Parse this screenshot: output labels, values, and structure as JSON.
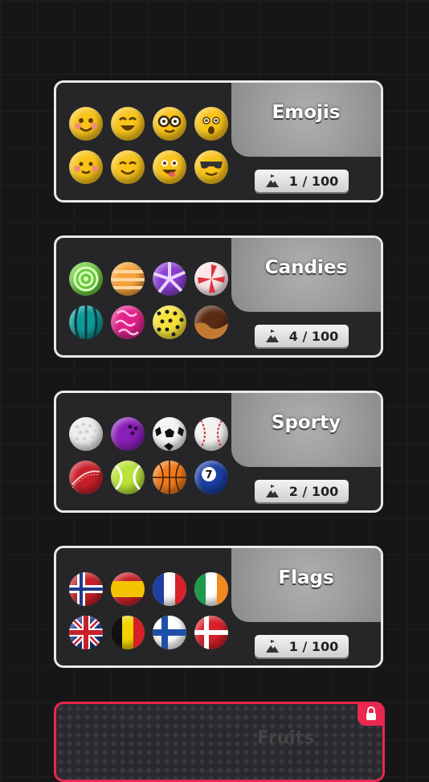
{
  "categories": [
    {
      "name": "Emojis",
      "progress": "1 / 100"
    },
    {
      "name": "Candies",
      "progress": "4 / 100"
    },
    {
      "name": "Sporty",
      "progress": "2 / 100"
    },
    {
      "name": "Flags",
      "progress": "1 / 100"
    }
  ],
  "locked_category": {
    "name": "Fruits"
  },
  "icons": {
    "progress": "mountain-flag-icon",
    "lock": "lock-icon"
  }
}
